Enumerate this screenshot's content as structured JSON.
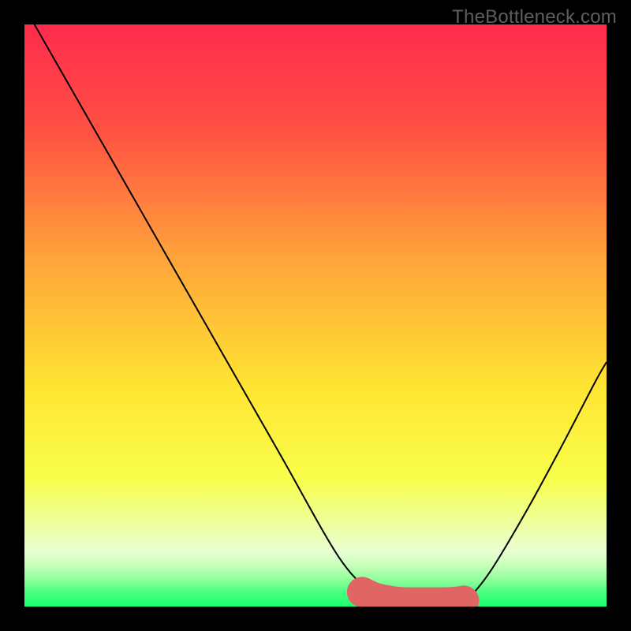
{
  "watermark": "TheBottleneck.com",
  "chart_data": {
    "type": "line",
    "title": "",
    "xlabel": "",
    "ylabel": "",
    "xlim": [
      0,
      100
    ],
    "ylim": [
      0,
      100
    ],
    "background_gradient": {
      "stops": [
        {
          "offset": 0.0,
          "color": "#ff2b4d"
        },
        {
          "offset": 0.18,
          "color": "#ff5043"
        },
        {
          "offset": 0.4,
          "color": "#ffa33a"
        },
        {
          "offset": 0.62,
          "color": "#ffe432"
        },
        {
          "offset": 0.78,
          "color": "#f8ff4a"
        },
        {
          "offset": 0.86,
          "color": "#edffa0"
        },
        {
          "offset": 0.905,
          "color": "#e9ffd4"
        },
        {
          "offset": 0.93,
          "color": "#c6ffb8"
        },
        {
          "offset": 0.955,
          "color": "#8cff9a"
        },
        {
          "offset": 0.975,
          "color": "#4aff80"
        },
        {
          "offset": 1.0,
          "color": "#1aff70"
        }
      ]
    },
    "series": [
      {
        "name": "bottleneck-curve",
        "color": "#000000",
        "x": [
          0,
          2,
          6,
          14,
          24,
          34,
          44,
          54,
          60,
          62,
          64,
          66,
          68,
          70,
          72,
          74,
          76,
          80,
          86,
          92,
          98,
          100
        ],
        "y": [
          103,
          99.5,
          92.5,
          78.5,
          61,
          43.5,
          26,
          8.5,
          2.0,
          1.0,
          0.7,
          0.6,
          0.6,
          0.6,
          0.6,
          0.7,
          1.2,
          6,
          16,
          27,
          38.5,
          42
        ]
      }
    ],
    "trough_marker": {
      "color": "#e06666",
      "points_xy": [
        [
          58,
          2.5
        ],
        [
          60,
          1.6
        ],
        [
          62,
          1.1
        ],
        [
          64,
          0.8
        ],
        [
          66,
          0.7
        ],
        [
          68,
          0.7
        ],
        [
          70,
          0.7
        ],
        [
          72,
          0.7
        ],
        [
          74,
          0.8
        ],
        [
          75.5,
          1.0
        ]
      ],
      "radius": 2.6
    }
  }
}
